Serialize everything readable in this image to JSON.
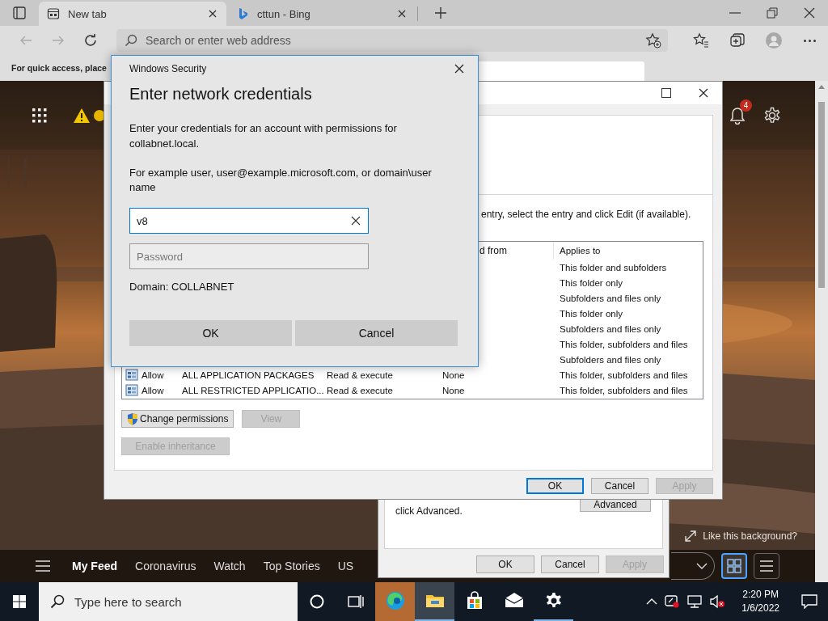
{
  "browser": {
    "tabs": [
      {
        "label": "New tab",
        "selected": true,
        "kind": "newtab"
      },
      {
        "label": "cttun - Bing",
        "selected": false,
        "kind": "site"
      }
    ],
    "address_bar": {
      "placeholder": "Search or enter web address"
    },
    "favorites_bar": {
      "text": "For quick access, place"
    },
    "new_tab_page": {
      "notification_count": "4",
      "background_prompt": "Like this background?",
      "feed_tabs": [
        {
          "label": "My Feed",
          "selected": true
        },
        {
          "label": "Coronavirus",
          "selected": false
        },
        {
          "label": "Watch",
          "selected": false
        },
        {
          "label": "Top Stories",
          "selected": false
        },
        {
          "label": "US",
          "selected": false
        }
      ],
      "view_buttons": [
        {
          "kind": "grid",
          "selected": true
        },
        {
          "kind": "list",
          "selected": false
        }
      ]
    }
  },
  "properties_window": {
    "note": "click Advanced.",
    "buttons": [
      {
        "label": "Advanced",
        "disabled": false
      }
    ],
    "footer_buttons": [
      {
        "label": "OK",
        "disabled": false
      },
      {
        "label": "Cancel",
        "disabled": false
      },
      {
        "label": "Apply",
        "disabled": true
      }
    ]
  },
  "security_settings_window": {
    "instruction": "entry, select the entry and click Edit (if available).",
    "table": {
      "columns": [
        "d from",
        "Applies to"
      ],
      "rows": [
        {
          "applies_to": "This folder and subfolders"
        },
        {
          "applies_to": "This folder only"
        },
        {
          "applies_to": "Subfolders and files only"
        },
        {
          "applies_to": "This folder only"
        },
        {
          "applies_to": "Subfolders and files only"
        },
        {
          "applies_to": "This folder, subfolders and files"
        },
        {
          "applies_to": "Subfolders and files only"
        },
        {
          "type": "Allow",
          "principal": "ALL APPLICATION PACKAGES",
          "access": "Read & execute",
          "inherited_from": "None",
          "applies_to": "This folder, subfolders and files"
        },
        {
          "type": "Allow",
          "principal": "ALL RESTRICTED APPLICATIO...",
          "access": "Read & execute",
          "inherited_from": "None",
          "applies_to": "This folder, subfolders and files"
        }
      ]
    },
    "buttons": [
      {
        "label": "Change permissions",
        "disabled": false,
        "kind": "shield"
      },
      {
        "label": "View",
        "disabled": true,
        "kind": "plain"
      }
    ],
    "inheritance_button": {
      "label": "Enable inheritance",
      "disabled": true
    },
    "footer_buttons": [
      {
        "label": "OK",
        "disabled": false,
        "focused": true
      },
      {
        "label": "Cancel",
        "disabled": false,
        "focused": false
      },
      {
        "label": "Apply",
        "disabled": true,
        "focused": false
      }
    ]
  },
  "credentials_dialog": {
    "title": "Windows Security",
    "heading": "Enter network credentials",
    "message": "Enter your credentials for an account with permissions for collabnet.local.",
    "example": "For example user, user@example.microsoft.com, or domain\\user name",
    "username": {
      "value": "v8"
    },
    "password": {
      "placeholder": "Password"
    },
    "domain": "Domain: COLLABNET",
    "buttons": [
      "OK",
      "Cancel"
    ]
  },
  "taskbar": {
    "search": {
      "placeholder": "Type here to search"
    },
    "apps": [
      {
        "kind": "edge",
        "running": false,
        "selected": false,
        "flashing": true
      },
      {
        "kind": "explorer",
        "running": true,
        "selected": true,
        "flashing": false
      },
      {
        "kind": "store",
        "running": false,
        "selected": false,
        "flashing": false
      },
      {
        "kind": "mail",
        "running": false,
        "selected": false,
        "flashing": false
      },
      {
        "kind": "settings",
        "running": true,
        "selected": false,
        "flashing": false
      }
    ],
    "clock": {
      "time": "2:20 PM",
      "date": "1/6/2022"
    }
  }
}
